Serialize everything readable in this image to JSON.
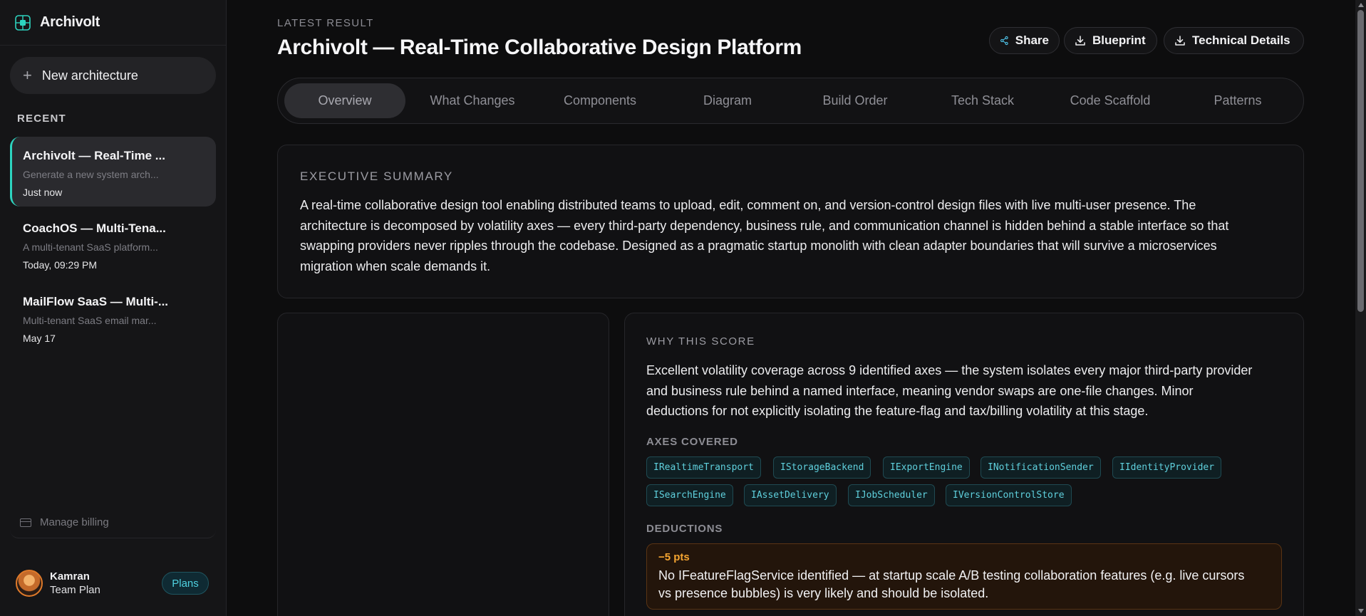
{
  "app": {
    "name": "Archivolt"
  },
  "sidebar": {
    "new_button": "New architecture",
    "recent_heading": "RECENT",
    "conversations": [
      {
        "title": "Archivolt — Real-Time ...",
        "subtitle": "Generate a new system arch...",
        "date": "Just now",
        "active": true
      },
      {
        "title": "CoachOS — Multi-Tena...",
        "subtitle": "A multi-tenant SaaS platform...",
        "date": "Today, 09:29 PM",
        "active": false
      },
      {
        "title": "MailFlow SaaS — Multi-...",
        "subtitle": "Multi-tenant SaaS email mar...",
        "date": "May 17",
        "active": false
      }
    ],
    "billing": "Manage billing",
    "user": {
      "name": "Kamran",
      "plan": "Team Plan",
      "plans_button": "Plans"
    }
  },
  "header": {
    "kicker": "LATEST RESULT",
    "title": "Archivolt — Real-Time Collaborative Design Platform",
    "actions": {
      "share": "Share",
      "blueprint": "Blueprint",
      "technical": "Technical Details"
    }
  },
  "tabs": [
    "Overview",
    "What Changes",
    "Components",
    "Diagram",
    "Build Order",
    "Tech Stack",
    "Code Scaffold",
    "Patterns"
  ],
  "active_tab": "Overview",
  "summary": {
    "heading": "EXECUTIVE SUMMARY",
    "lines": [
      "A real-time collaborative design tool enabling distributed teams to upload, edit, comment on, and version-control design files with live multi-user presence. The",
      "architecture is decomposed by volatility axes — every third-party dependency, business rule, and communication channel is hidden behind a stable interface so that",
      "swapping providers never ripples through the codebase. Designed as a pragmatic startup monolith with clean adapter boundaries that will survive a microservices",
      "migration when scale demands it."
    ]
  },
  "score": {
    "heading": "WHY THIS SCORE",
    "lines": [
      "Excellent volatility coverage across 9 identified axes — the system isolates every major third-party provider",
      "and business rule behind a named interface, meaning vendor swaps are one-file changes. Minor",
      "deductions for not explicitly isolating the feature-flag and tax/billing volatility at this stage."
    ],
    "axes_heading": "AXES COVERED",
    "axes": [
      "IRealtimeTransport",
      "IStorageBackend",
      "IExportEngine",
      "INotificationSender",
      "IIdentityProvider",
      "ISearchEngine",
      "IAssetDelivery",
      "IJobScheduler",
      "IVersionControlStore"
    ],
    "deductions_heading": "DEDUCTIONS",
    "deductions": [
      {
        "points": "−5 pts",
        "lines": [
          "No IFeatureFlagService identified — at startup scale A/B testing collaboration features (e.g. live cursors",
          "vs presence bubbles) is very likely and should be isolated."
        ]
      }
    ]
  },
  "colors": {
    "accent": "#2dd4bf",
    "chip_text": "#5fd0dd",
    "deduction": "#f5a531",
    "background": "#0d0d0e"
  }
}
